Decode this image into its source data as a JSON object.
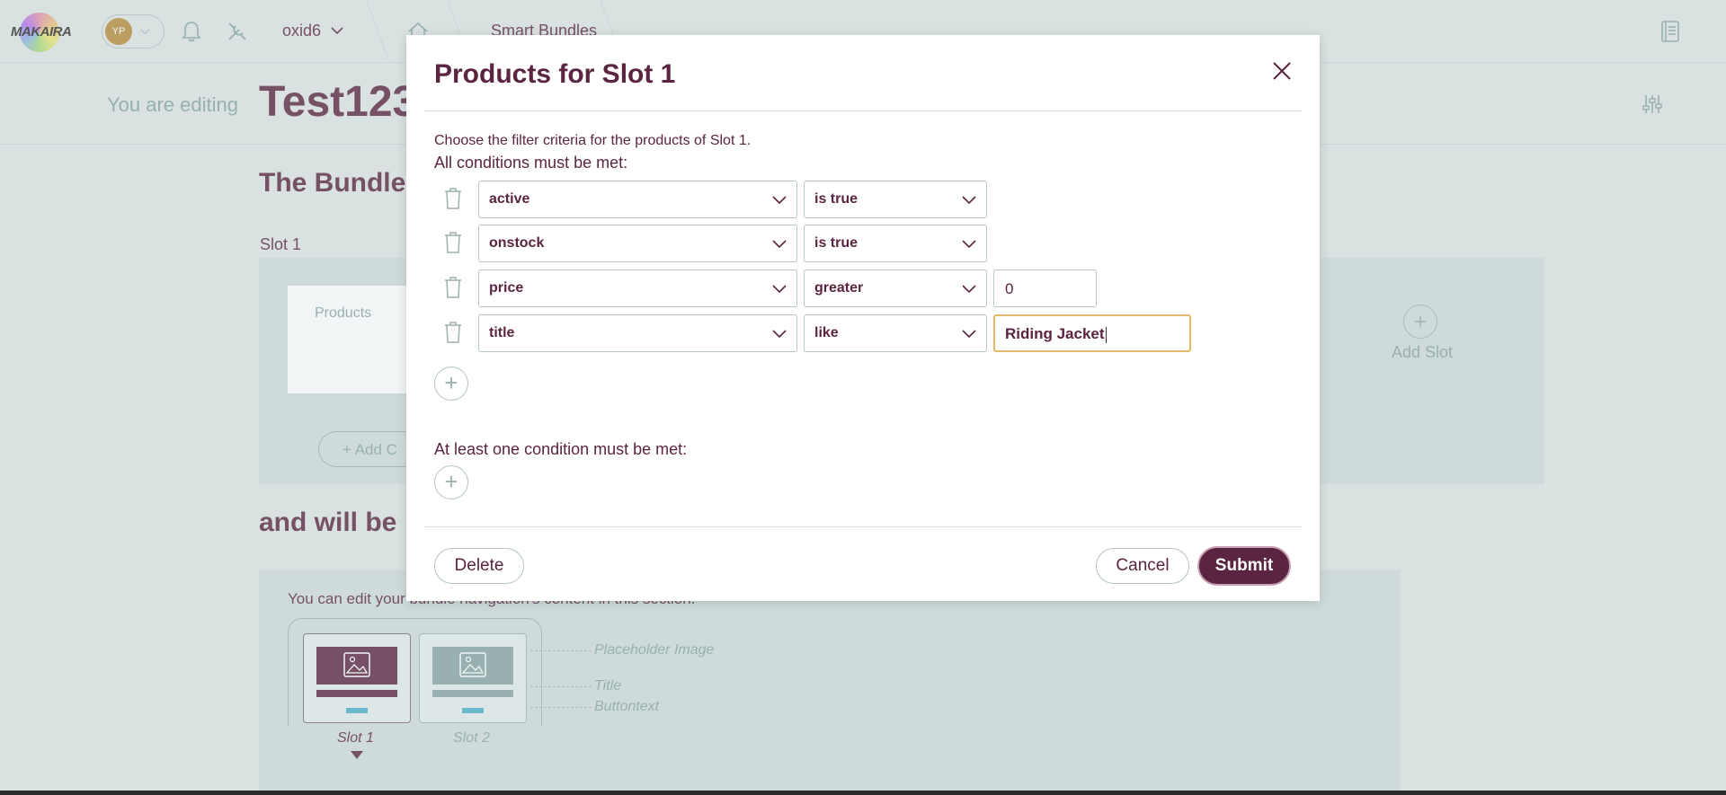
{
  "topbar": {
    "logo_text": "MAKAIRA",
    "avatar_initials": "YP",
    "instance_label": "oxid6",
    "breadcrumb": "Smart Bundles"
  },
  "editing": {
    "prefix": "You are editing",
    "title": "Test123"
  },
  "background": {
    "bundle_heading": "The Bundle",
    "slot_label": "Slot 1",
    "products_card_label": "Products",
    "add_button_label": "+ Add C",
    "add_slot_label": "Add Slot",
    "and_heading": "and will be",
    "nav_description": "You can edit your bundle navigation's content in this section.",
    "preview": {
      "slot1_label": "Slot 1",
      "slot2_label": "Slot 2",
      "legend_placeholder": "Placeholder Image",
      "legend_title": "Title",
      "legend_button": "Buttontext"
    }
  },
  "modal": {
    "title": "Products for Slot 1",
    "intro": "Choose the filter criteria for the products of Slot 1.",
    "all_heading": "All conditions must be met:",
    "any_heading": "At least one condition must be met:",
    "conditions": [
      {
        "field": "active",
        "operator": "is true",
        "value": null
      },
      {
        "field": "onstock",
        "operator": "is true",
        "value": null
      },
      {
        "field": "price",
        "operator": "greater",
        "value": "0"
      },
      {
        "field": "title",
        "operator": "like",
        "value": "Riding Jacket"
      }
    ],
    "delete_label": "Delete",
    "cancel_label": "Cancel",
    "submit_label": "Submit"
  },
  "colors": {
    "primary": "#5b2440",
    "focus_border": "#e2b766",
    "muted": "#8aa3a3",
    "background": "#dfe5e5"
  }
}
